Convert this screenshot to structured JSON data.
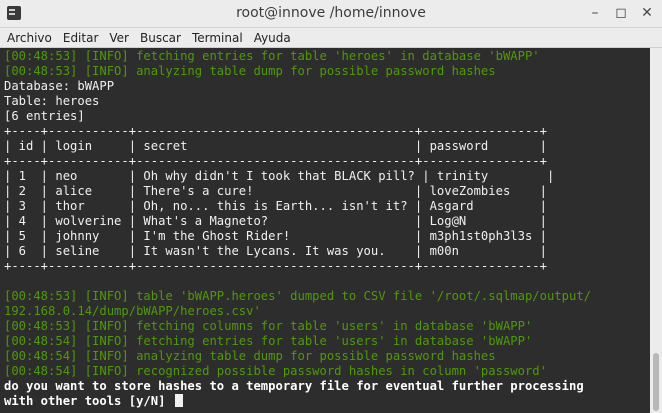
{
  "window": {
    "title": "root@innove /home/innove"
  },
  "menu": [
    "Archivo",
    "Editar",
    "Ver",
    "Buscar",
    "Terminal",
    "Ayuda"
  ],
  "colors": {
    "info": "#4e9a06",
    "text": "#f0f0f0",
    "background": "#2d2d2d"
  },
  "icons": {
    "app": "terminal-icon",
    "minimize": "minimize-icon",
    "maximize": "maximize-icon",
    "close": "close-icon"
  },
  "terminal": {
    "lines": [
      "[00:48:53] [INFO] fetching entries for table 'heroes' in database 'bWAPP'",
      "[00:48:53] [INFO] analyzing table dump for possible password hashes",
      "Database: bWAPP",
      "Table: heroes",
      "[6 entries]",
      "+----+-----------+--------------------------------------+----------------+",
      "| id | login     | secret                               | password       |",
      "+----+-----------+--------------------------------------+----------------+",
      "| 1  | neo       | Oh why didn't I took that BLACK pill? | trinity        |",
      "| 2  | alice     | There's a cure!                      | loveZombies    |",
      "| 3  | thor      | Oh, no... this is Earth... isn't it? | Asgard         |",
      "| 4  | wolverine | What's a Magneto?                    | Log@N          |",
      "| 5  | johnny    | I'm the Ghost Rider!                 | m3ph1st0ph3l3s |",
      "| 6  | seline    | It wasn't the Lycans. It was you.    | m00n           |",
      "+----+-----------+--------------------------------------+----------------+",
      "",
      "[00:48:53] [INFO] table 'bWAPP.heroes' dumped to CSV file '/root/.sqlmap/output/",
      "192.168.0.14/dump/bWAPP/heroes.csv'",
      "[00:48:53] [INFO] fetching columns for table 'users' in database 'bWAPP'",
      "[00:48:54] [INFO] fetching entries for table 'users' in database 'bWAPP'",
      "[00:48:54] [INFO] analyzing table dump for possible password hashes",
      "[00:48:54] [INFO] recognized possible password hashes in column 'password'",
      "do you want to store hashes to a temporary file for eventual further processing",
      "with other tools [y/N] "
    ]
  }
}
